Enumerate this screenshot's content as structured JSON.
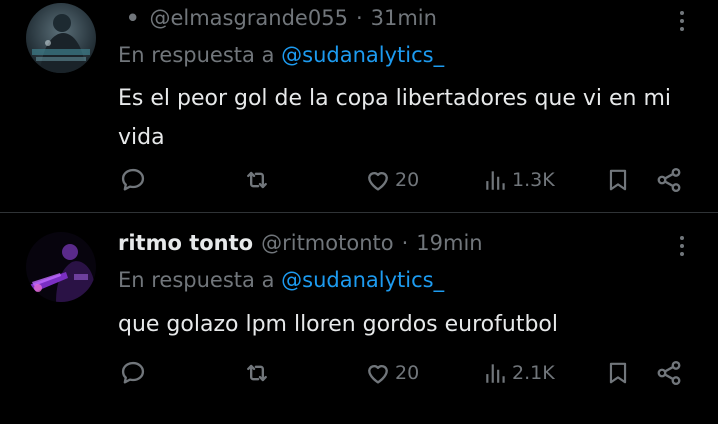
{
  "colors": {
    "background": "#000000",
    "text": "#e7e9ea",
    "muted": "#71767b",
    "link": "#1d9bf0",
    "divider": "#2f3336"
  },
  "tweets": [
    {
      "display_name": "",
      "username": "@elmasgrande055",
      "time": "31min",
      "reply_prefix": "En respuesta a",
      "reply_handle": "@sudanalytics_",
      "text": "Es el peor gol de la copa libertadores que vi en mi vida",
      "likes": "20",
      "views": "1.3K",
      "icons": [
        "reply-icon",
        "retweet-icon",
        "like-icon",
        "views-icon",
        "bookmark-icon",
        "share-icon",
        "more-icon"
      ]
    },
    {
      "display_name": "ritmo tonto",
      "username": "@ritmotonto",
      "time": "19min",
      "reply_prefix": "En respuesta a",
      "reply_handle": "@sudanalytics_",
      "text": "que golazo lpm lloren gordos eurofutbol",
      "likes": "20",
      "views": "2.1K",
      "icons": [
        "reply-icon",
        "retweet-icon",
        "like-icon",
        "views-icon",
        "bookmark-icon",
        "share-icon",
        "more-icon"
      ]
    }
  ]
}
